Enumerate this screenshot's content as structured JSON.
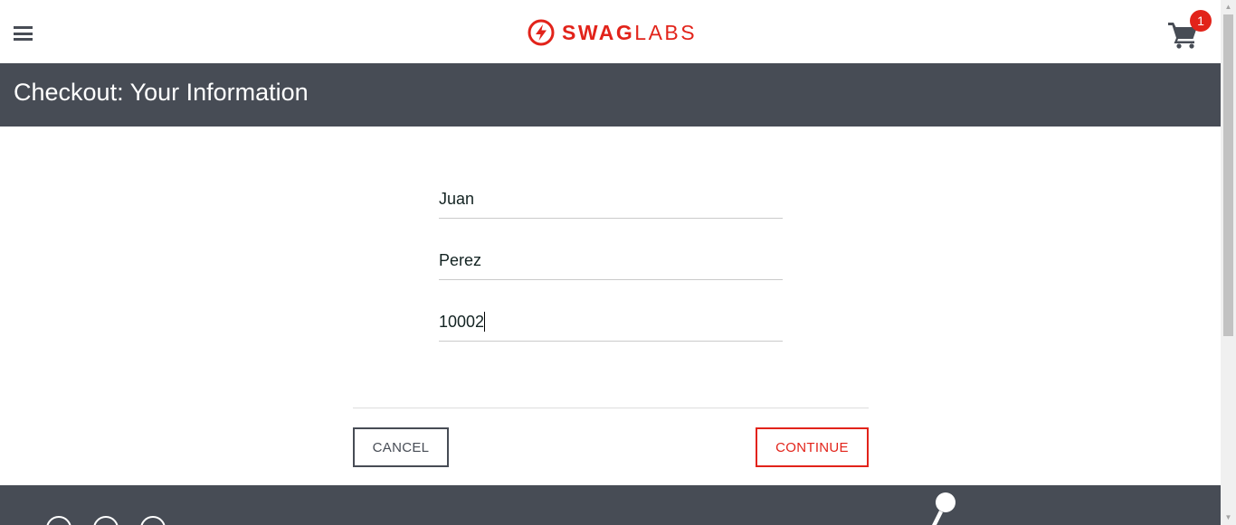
{
  "header": {
    "menu_icon": "hamburger-menu-icon",
    "logo": {
      "bold": "SWAG",
      "light": "LABS",
      "icon": "swag-bolt-icon"
    },
    "cart": {
      "icon": "shopping-cart-icon",
      "badge_count": "1"
    }
  },
  "subheader": {
    "title": "Checkout: Your Information"
  },
  "form": {
    "first_name": "Juan",
    "last_name": "Perez",
    "postal_code": "10002"
  },
  "actions": {
    "cancel_label": "CANCEL",
    "continue_label": "CONTINUE"
  },
  "footer": {
    "social_icons": [
      "twitter-icon",
      "facebook-icon",
      "linkedin-icon"
    ]
  },
  "colors": {
    "accent": "#e2231a",
    "dark": "#474c55",
    "text": "#132322"
  }
}
